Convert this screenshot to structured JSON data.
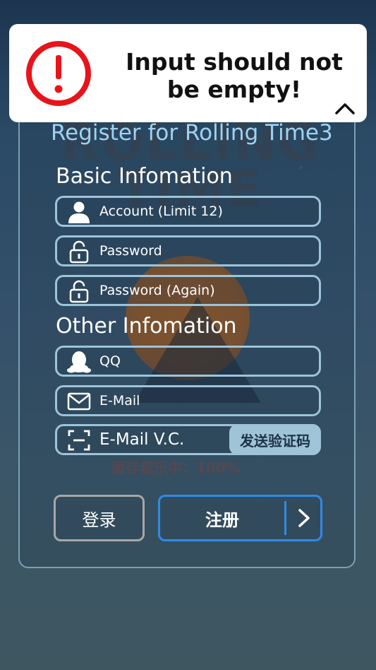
{
  "toast": {
    "message": "Input should not be empty!",
    "icon": "alert-circle-icon",
    "collapse_icon": "chevron-up-icon"
  },
  "background": {
    "logo_text": "ROLLING TIME",
    "progress_text": "缓存音乐中：100%"
  },
  "form": {
    "title": "Register for Rolling Time3",
    "basic_section": "Basic Infomation",
    "other_section": "Other Infomation",
    "account_placeholder": "Account (Limit 12)",
    "password_placeholder": "Password",
    "password_again_placeholder": "Password (Again)",
    "qq_placeholder": "QQ",
    "email_placeholder": "E-Mail",
    "email_vc_placeholder": "E-Mail V.C.",
    "send_code_label": "发送验证码"
  },
  "actions": {
    "login_label": "登录",
    "register_label": "注册"
  },
  "colors": {
    "accent_blue": "#2f8ae6",
    "title_blue": "#9fd2f2",
    "alert_red": "#e8141b",
    "field_border": "#9cc4da"
  }
}
